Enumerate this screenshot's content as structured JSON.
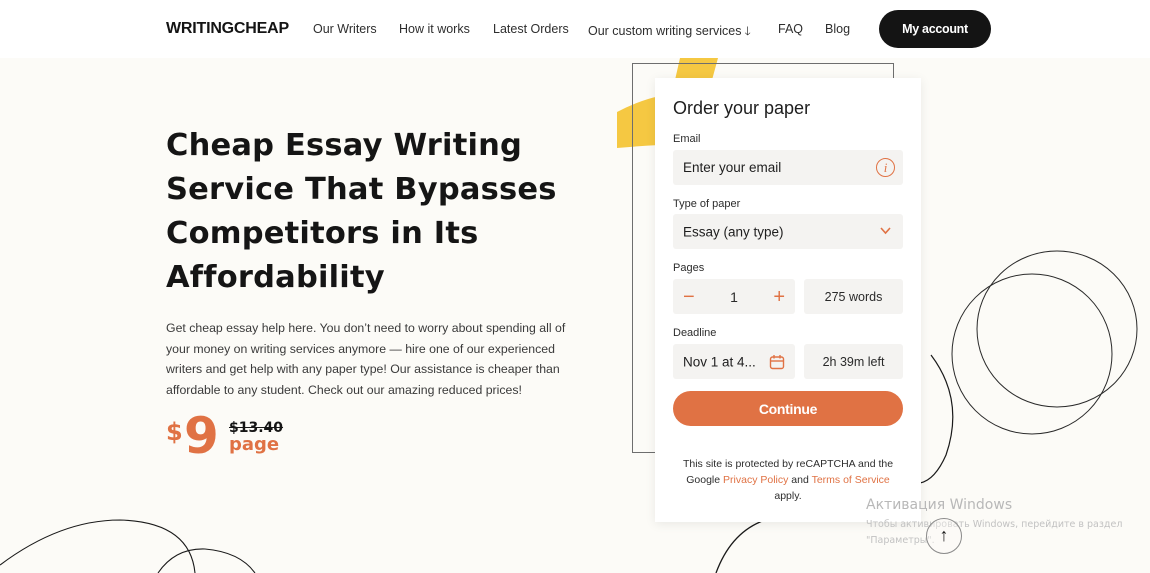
{
  "header": {
    "logo": "WRITINGCHEAP",
    "nav": [
      {
        "label": "Our Writers"
      },
      {
        "label": "How it works"
      },
      {
        "label": "Latest Orders"
      },
      {
        "label": "Our custom writing services",
        "icon": "arrow-down-icon"
      },
      {
        "label": "FAQ"
      },
      {
        "label": "Blog"
      }
    ],
    "account_button": "My account"
  },
  "hero": {
    "title": "Cheap Essay Writing Service That Bypasses Competitors in Its Affordability",
    "description": "Get cheap essay help here. You don’t need to worry about spending all of your money on writing services anymore — hire one of our experienced writers and get help with any paper type! Our assistance is cheaper than affordable to any student. Check out our amazing reduced prices!",
    "price": {
      "currency": "$",
      "amount": "9",
      "old_price": "$13.40",
      "unit": "page"
    }
  },
  "order_form": {
    "title": "Order your paper",
    "email": {
      "label": "Email",
      "placeholder": "Enter your email",
      "value": "",
      "icon": "info-icon"
    },
    "paper_type": {
      "label": "Type of paper",
      "value": "Essay (any type)",
      "icon": "chevron-down-icon"
    },
    "pages": {
      "label": "Pages",
      "value": "1",
      "words": "275 words",
      "minus_icon": "minus-icon",
      "plus_icon": "plus-icon"
    },
    "deadline": {
      "label": "Deadline",
      "value": "Nov 1 at 4...",
      "time_left": "2h 39m left",
      "icon": "calendar-icon"
    },
    "continue_button": "Continue",
    "recaptcha": {
      "prefix": "This site is protected by reCAPTCHA and the Google",
      "privacy_link": "Privacy Policy",
      "and": "and",
      "terms_link": "Terms of Service",
      "suffix": "apply."
    }
  },
  "colors": {
    "accent": "#e07244",
    "yellow": "#f5c842",
    "dark": "#141414",
    "background": "#fcfbf7",
    "field": "#f4f3f1"
  },
  "watermark": {
    "title": "Активация Windows",
    "subtitle": "Чтобы активировать Windows, перейдите в раздел \"Параметры\"."
  },
  "scroll_top": {
    "icon": "arrow-up-icon",
    "glyph": "↑"
  }
}
